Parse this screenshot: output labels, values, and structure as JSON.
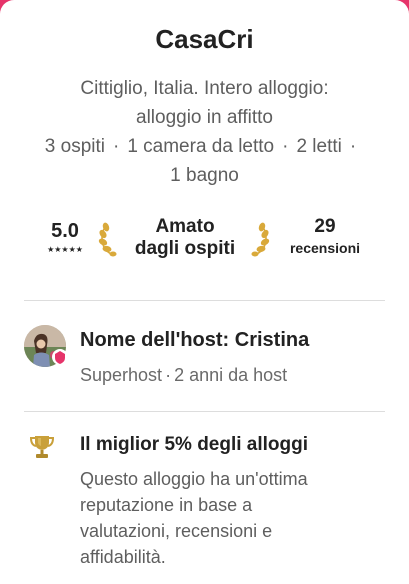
{
  "listing": {
    "title": "CasaCri",
    "subtitle_lines": [
      "Cittiglio, Italia. Intero alloggio:",
      "alloggio in affitto"
    ],
    "details": {
      "guests": "3 ospiti",
      "bedrooms": "1 camera da letto",
      "beds": "2 letti",
      "separator": "·",
      "bathrooms": "1 bagno"
    }
  },
  "stats": {
    "rating": "5.0",
    "stars": "★★★★★",
    "guest_favorite_line1": "Amato",
    "guest_favorite_line2": "dagli ospiti",
    "reviews_count": "29",
    "reviews_label": "recensioni"
  },
  "host": {
    "name": "Nome dell'host: Cristina",
    "status": "Superhost",
    "separator": "·",
    "tenure": "2 anni da host"
  },
  "highlight": {
    "title": "Il miglior 5% degli alloggi",
    "description_lines": [
      "Questo alloggio ha un'ottima",
      "reputazione in base a",
      "valutazioni, recensioni e",
      "affidabilità."
    ]
  },
  "icons": {
    "laurel": "laurel-icon",
    "trophy": "trophy-icon",
    "superhost_badge": "superhost-badge-icon"
  },
  "colors": {
    "brand": "#e6346a",
    "gold": "#d9a93a",
    "text_primary": "#222222",
    "text_secondary": "#5e5e5e"
  }
}
